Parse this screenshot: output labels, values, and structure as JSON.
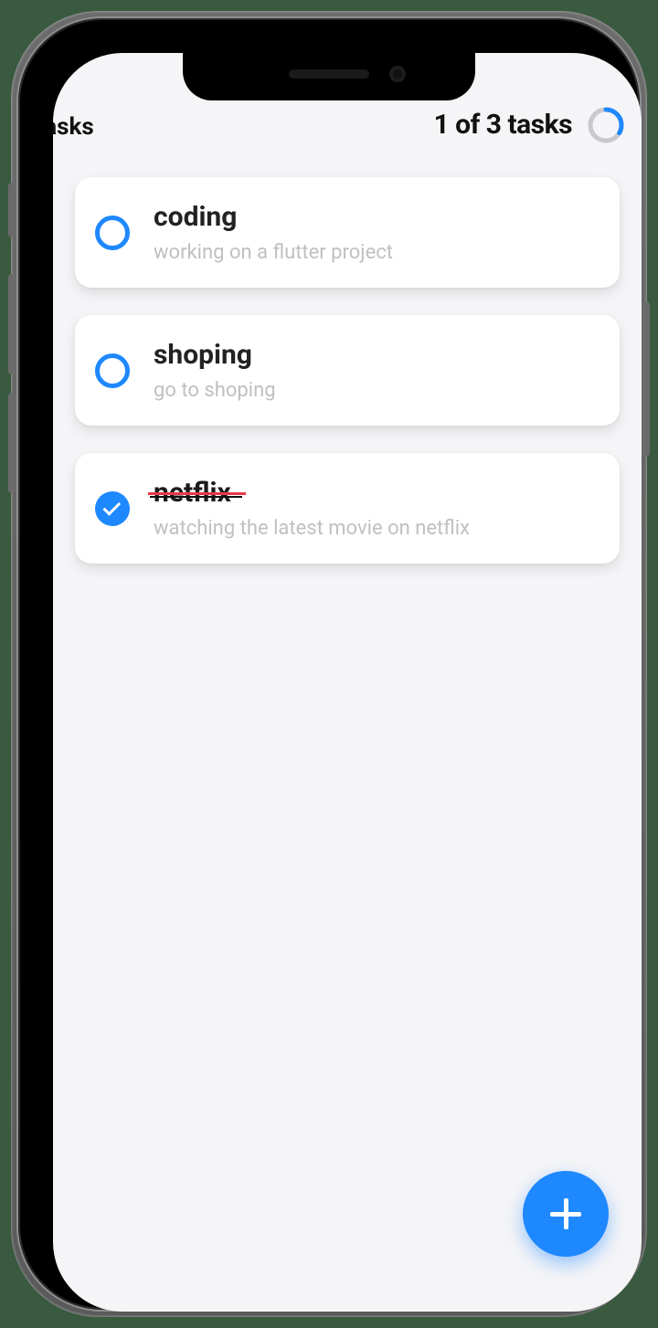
{
  "appbar": {
    "title": "Tasks",
    "task_count_label": "1 of 3 tasks"
  },
  "progress": {
    "completed": 1,
    "total": 3,
    "fraction": 0.333,
    "ring_color": "#1e88ff",
    "track_color": "#c9c9cc"
  },
  "fab": {
    "action": "add-task",
    "icon_name": "plus-icon"
  },
  "colors": {
    "accent": "#1e88ff",
    "background": "#f5f5f7",
    "card": "#ffffff",
    "strike": "#e63946",
    "muted": "#c0c0c4"
  },
  "tasks": [
    {
      "title": "coding",
      "subtitle": "working on a flutter project",
      "done": false
    },
    {
      "title": "shoping",
      "subtitle": "go to shoping",
      "done": false
    },
    {
      "title": "netflix",
      "subtitle": "watching the latest movie on netflix",
      "done": true
    }
  ]
}
